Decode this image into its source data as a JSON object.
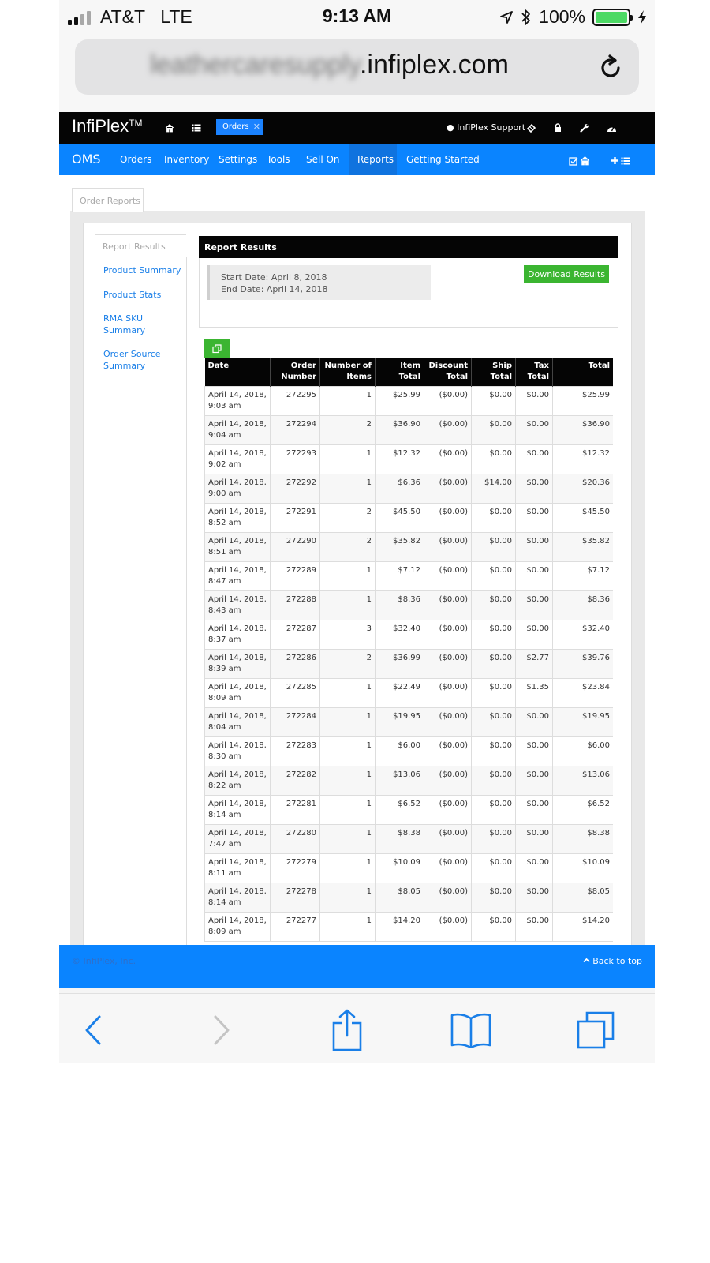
{
  "status": {
    "carrier": "AT&T",
    "network": "LTE",
    "time": "9:13 AM",
    "battery": "100%"
  },
  "browser": {
    "domain_blurred": "leathercaresupply",
    "domain_visible": ".infiplex.com"
  },
  "header": {
    "brand": "InfiPlex",
    "brand_tm": "TM",
    "open_tab": "Orders",
    "support_label": "InfiPlex Support"
  },
  "nav": {
    "brand": "OMS",
    "items": [
      "Orders",
      "Inventory",
      "Settings",
      "Tools",
      "Sell On",
      "Reports",
      "Getting Started"
    ]
  },
  "page": {
    "tab": "Order Reports"
  },
  "sidebar": {
    "active": "Report Results",
    "links": [
      "Product Summary",
      "Product Stats",
      "RMA SKU Summary",
      "Order Source Summary"
    ]
  },
  "report": {
    "title": "Report Results",
    "start_date": "Start Date: April 8, 2018",
    "end_date": "End Date: April 14, 2018",
    "download_label": "Download Results",
    "columns": [
      "Date",
      "Order Number",
      "Number of Items",
      "Item Total",
      "Discount Total",
      "Ship Total",
      "Tax Total",
      "Total"
    ],
    "rows": [
      [
        "April 14, 2018, 9:03 am",
        "272295",
        "1",
        "$25.99",
        "($0.00)",
        "$0.00",
        "$0.00",
        "$25.99"
      ],
      [
        "April 14, 2018, 9:04 am",
        "272294",
        "2",
        "$36.90",
        "($0.00)",
        "$0.00",
        "$0.00",
        "$36.90"
      ],
      [
        "April 14, 2018, 9:02 am",
        "272293",
        "1",
        "$12.32",
        "($0.00)",
        "$0.00",
        "$0.00",
        "$12.32"
      ],
      [
        "April 14, 2018, 9:00 am",
        "272292",
        "1",
        "$6.36",
        "($0.00)",
        "$14.00",
        "$0.00",
        "$20.36"
      ],
      [
        "April 14, 2018, 8:52 am",
        "272291",
        "2",
        "$45.50",
        "($0.00)",
        "$0.00",
        "$0.00",
        "$45.50"
      ],
      [
        "April 14, 2018, 8:51 am",
        "272290",
        "2",
        "$35.82",
        "($0.00)",
        "$0.00",
        "$0.00",
        "$35.82"
      ],
      [
        "April 14, 2018, 8:47 am",
        "272289",
        "1",
        "$7.12",
        "($0.00)",
        "$0.00",
        "$0.00",
        "$7.12"
      ],
      [
        "April 14, 2018, 8:43 am",
        "272288",
        "1",
        "$8.36",
        "($0.00)",
        "$0.00",
        "$0.00",
        "$8.36"
      ],
      [
        "April 14, 2018, 8:37 am",
        "272287",
        "3",
        "$32.40",
        "($0.00)",
        "$0.00",
        "$0.00",
        "$32.40"
      ],
      [
        "April 14, 2018, 8:39 am",
        "272286",
        "2",
        "$36.99",
        "($0.00)",
        "$0.00",
        "$2.77",
        "$39.76"
      ],
      [
        "April 14, 2018, 8:09 am",
        "272285",
        "1",
        "$22.49",
        "($0.00)",
        "$0.00",
        "$1.35",
        "$23.84"
      ],
      [
        "April 14, 2018, 8:04 am",
        "272284",
        "1",
        "$19.95",
        "($0.00)",
        "$0.00",
        "$0.00",
        "$19.95"
      ],
      [
        "April 14, 2018, 8:30 am",
        "272283",
        "1",
        "$6.00",
        "($0.00)",
        "$0.00",
        "$0.00",
        "$6.00"
      ],
      [
        "April 14, 2018, 8:22 am",
        "272282",
        "1",
        "$13.06",
        "($0.00)",
        "$0.00",
        "$0.00",
        "$13.06"
      ],
      [
        "April 14, 2018, 8:14 am",
        "272281",
        "1",
        "$6.52",
        "($0.00)",
        "$0.00",
        "$0.00",
        "$6.52"
      ],
      [
        "April 14, 2018, 7:47 am",
        "272280",
        "1",
        "$8.38",
        "($0.00)",
        "$0.00",
        "$0.00",
        "$8.38"
      ],
      [
        "April 14, 2018, 8:11 am",
        "272279",
        "1",
        "$10.09",
        "($0.00)",
        "$0.00",
        "$0.00",
        "$10.09"
      ],
      [
        "April 14, 2018, 8:14 am",
        "272278",
        "1",
        "$8.05",
        "($0.00)",
        "$0.00",
        "$0.00",
        "$8.05"
      ],
      [
        "April 14, 2018, 8:09 am",
        "272277",
        "1",
        "$14.20",
        "($0.00)",
        "$0.00",
        "$0.00",
        "$14.20"
      ]
    ]
  },
  "footer": {
    "copyright": "© InfiPlex, Inc.",
    "back_to_top": "Back to top"
  },
  "colors": {
    "brand_blue": "#0a84ff",
    "action_green": "#3bb531",
    "header_black": "#050505",
    "battery_green": "#4cd964"
  },
  "icons": [
    "signal-icon",
    "location-icon",
    "bluetooth-icon",
    "battery-icon",
    "charging-icon",
    "reload-icon",
    "home-icon",
    "list-icon",
    "user-icon",
    "ticket-icon",
    "lock-icon",
    "wrench-icon",
    "dashboard-icon",
    "check-square-icon",
    "plus-icon",
    "copy-icon",
    "chevron-up-icon",
    "back-arrow-icon",
    "forward-arrow-icon",
    "share-icon",
    "bookmarks-icon",
    "tabs-icon"
  ]
}
